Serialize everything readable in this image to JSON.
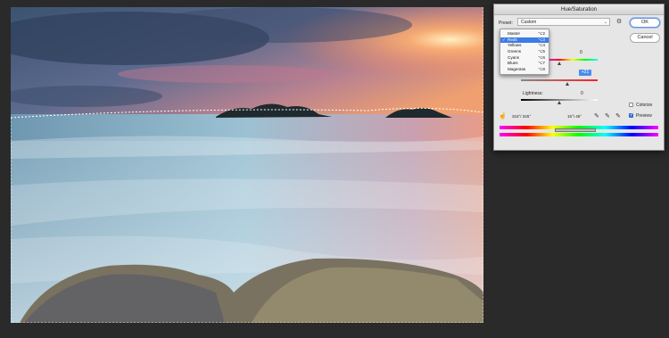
{
  "dialog": {
    "title": "Hue/Saturation",
    "preset_label": "Preset:",
    "preset_value": "Custom",
    "ok_label": "OK",
    "cancel_label": "Cancel",
    "menu": [
      {
        "label": "Master",
        "shortcut": "⌥2",
        "selected": false
      },
      {
        "label": "Reds",
        "shortcut": "⌥3",
        "selected": true
      },
      {
        "label": "Yellows",
        "shortcut": "⌥4",
        "selected": false
      },
      {
        "label": "Greens",
        "shortcut": "⌥5",
        "selected": false
      },
      {
        "label": "Cyans",
        "shortcut": "⌥6",
        "selected": false
      },
      {
        "label": "Blues",
        "shortcut": "⌥7",
        "selected": false
      },
      {
        "label": "Magentas",
        "shortcut": "⌥8",
        "selected": false
      }
    ],
    "hue_value": "0",
    "saturation_value": "+21",
    "lightness_label": "Lightness:",
    "lightness_value": "0",
    "colorize_label": "Colorize",
    "preview_label": "Preview",
    "range_left": "315°/ 345°",
    "range_right": "15°\\ 45°",
    "accent": "#3c7ce6"
  }
}
